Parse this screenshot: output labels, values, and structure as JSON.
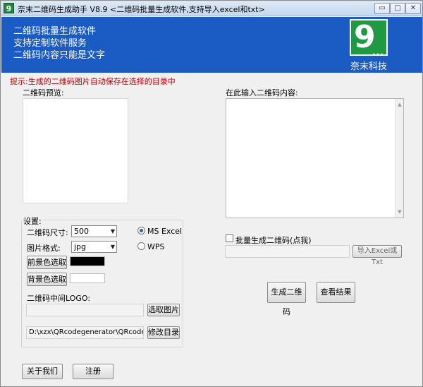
{
  "window": {
    "app_icon_glyph": "9",
    "title": "奈末二维码生成助手 V8.9    <二维码批量生成软件,支持导入excel和txt>",
    "controls": {
      "minimize": "▭",
      "maximize": "□",
      "close": "✕"
    }
  },
  "banner": {
    "lines": [
      "二维码批量生成软件",
      "支持定制软件服务",
      "二维码内容只能是文字"
    ],
    "logo_text": "9",
    "logo_dots": "...",
    "company": "奈末科技",
    "color": "#1b5cc4"
  },
  "hint": "提示:生成的二维码图片自动保存在选择的目录中",
  "preview": {
    "label": "二维码预览:"
  },
  "content": {
    "label": "在此输入二维码内容:",
    "value": "",
    "scroll_up": "▲",
    "scroll_down": "▼"
  },
  "settings": {
    "caption": "设置:",
    "size_label": "二维码尺寸:",
    "size_value": "500",
    "format_label": "图片格式:",
    "format_value": "jpg",
    "dropdown_arrow": "▼",
    "radio_excel": "MS  Excel",
    "radio_wps": "WPS",
    "excel_selected": true,
    "fg_button": "前景色选取",
    "fg_color": "#000000",
    "bg_button": "背景色选取",
    "bg_color": "#ffffff",
    "logo_label": "二维码中间LOGO:",
    "logo_path": "",
    "logo_button": "选取图片",
    "dir_path": "D:\\xzx\\QRcodegenerator\\QRcodeger",
    "dir_button": "修改目录"
  },
  "batch": {
    "checkbox_label": "批量生成二维码(点我)",
    "checked": false,
    "path": "",
    "import_button": "导入Excel或Txt"
  },
  "actions": {
    "generate": "生成二维码",
    "view": "查看结果",
    "about": "关于我们",
    "register": "注册"
  }
}
